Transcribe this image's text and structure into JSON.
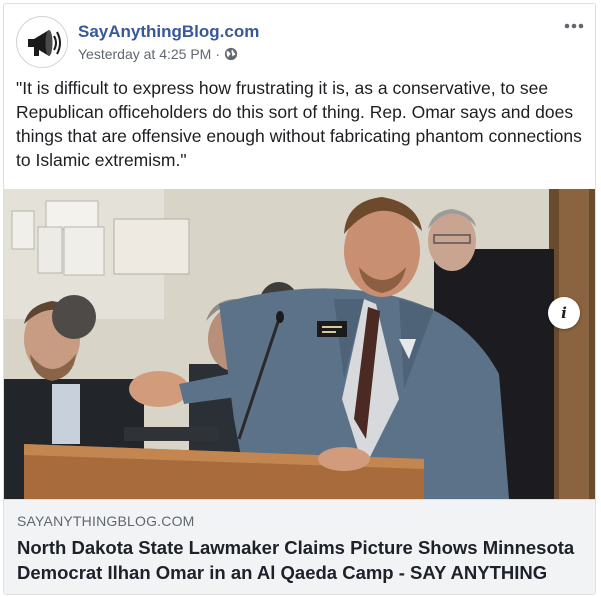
{
  "post": {
    "page_name": "SayAnythingBlog.com",
    "timestamp": "Yesterday at 4:25 PM",
    "separator": "·",
    "audience_icon": "globe-icon",
    "more_icon": "more-options-icon",
    "text": "\"It is difficult to express how frustrating it is, as a conservative, to see Republican officeholders do this sort of thing. Rep. Omar says and does things that are offensive enough without fabricating phantom connections to Islamic extremism.\""
  },
  "link_preview": {
    "domain": "SAYANYTHINGBLOG.COM",
    "title": "North Dakota State Lawmaker Claims Picture Shows Minnesota Democrat Ilhan Omar in an Al Qaeda Camp - SAY ANYTHING",
    "info_label": "i"
  },
  "colors": {
    "page_name": "#385898",
    "secondary_text": "#606770",
    "link_background": "#f2f3f5",
    "border": "#dddfe2"
  }
}
